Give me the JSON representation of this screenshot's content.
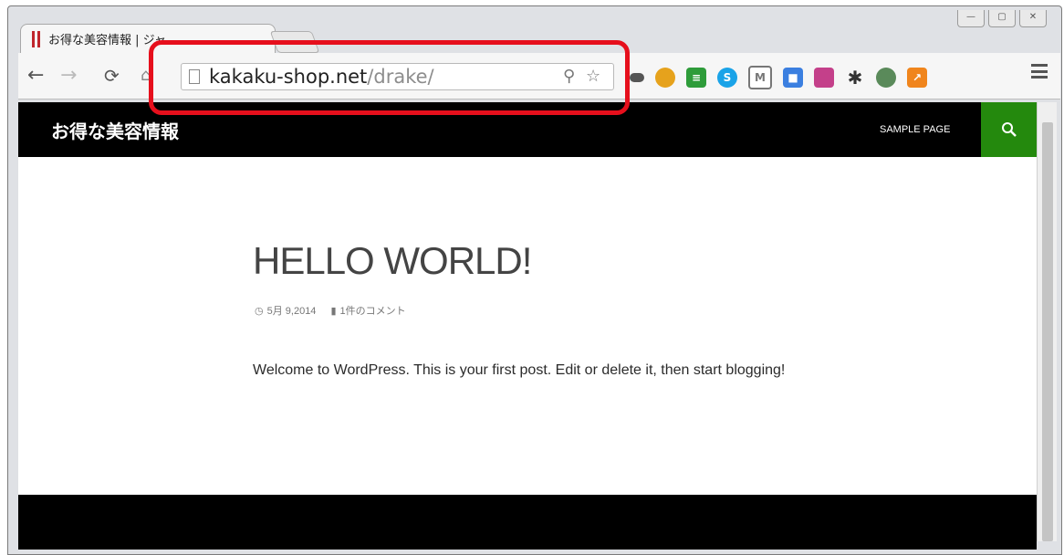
{
  "browser": {
    "tab_title": "お得な美容情報 | ジャ…",
    "url_domain": "kakaku-shop.net",
    "url_path": "/drake/",
    "window_controls": [
      "—",
      "▢",
      "✕"
    ],
    "extensions": [
      {
        "name": "ext-icon-1",
        "color": "#555555"
      },
      {
        "name": "ext-icon-2",
        "color": "#e6a21c"
      },
      {
        "name": "ext-icon-3",
        "color": "#2e9c3a"
      },
      {
        "name": "skype-icon",
        "color": "#1aa3e8"
      },
      {
        "name": "gmail-icon",
        "color": "#777777"
      },
      {
        "name": "ext-icon-6",
        "color": "#3b7fe0"
      },
      {
        "name": "ext-icon-7",
        "color": "#c4408a"
      },
      {
        "name": "ext-icon-8",
        "color": "#333333"
      },
      {
        "name": "ext-icon-9",
        "color": "#5a8a5a"
      },
      {
        "name": "analytics-icon",
        "color": "#f0851c"
      }
    ],
    "highlight_color": "#e60f1c"
  },
  "site": {
    "title": "お得な美容情報",
    "nav_link": "SAMPLE PAGE",
    "accent": "#24890d"
  },
  "post": {
    "title": "HELLO WORLD!",
    "date": "5月 9,2014",
    "comments": "1件のコメント",
    "body": "Welcome to WordPress. This is your first post. Edit or delete it, then start blogging!"
  }
}
